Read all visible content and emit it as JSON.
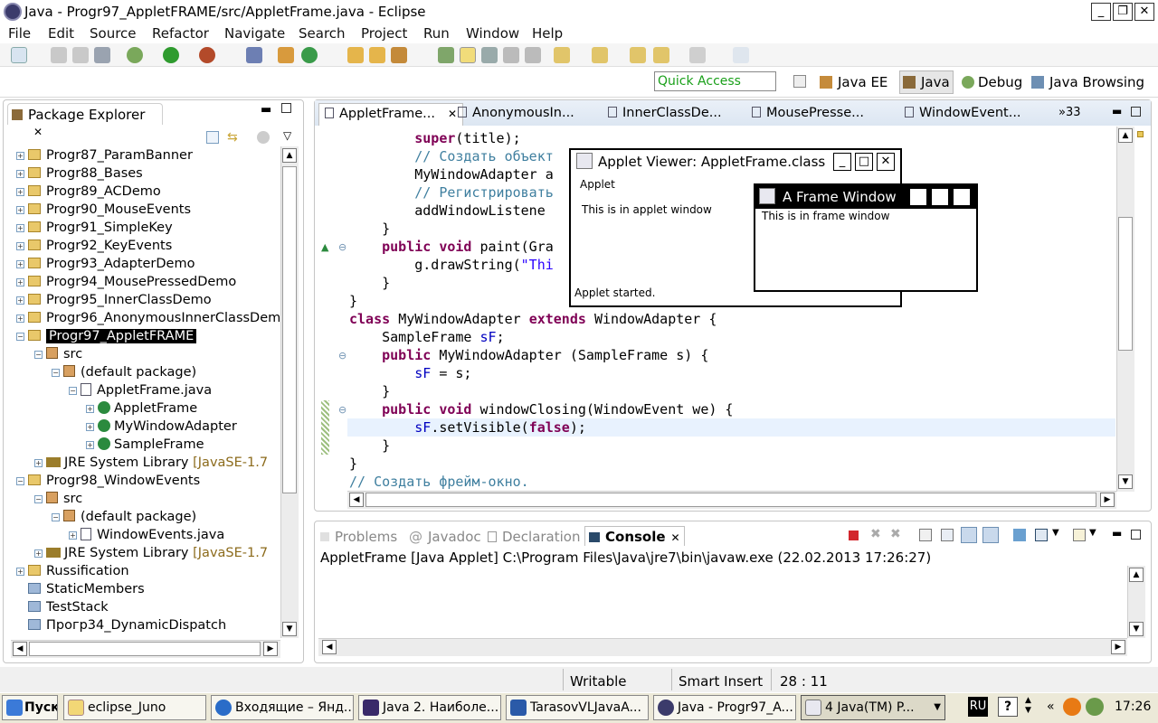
{
  "window": {
    "title": "Java - Progr97_AppletFRAME/src/AppletFrame.java - Eclipse"
  },
  "menu": [
    "File",
    "Edit",
    "Source",
    "Refactor",
    "Navigate",
    "Search",
    "Project",
    "Run",
    "Window",
    "Help"
  ],
  "quick_access": "Quick Access",
  "perspectives": [
    "Java EE",
    "Java",
    "Debug",
    "Java Browsing"
  ],
  "package_explorer": {
    "title": "Package Explorer",
    "rows": [
      "Progr87_ParamBanner",
      "Progr88_Bases",
      "Progr89_ACDemo",
      "Progr90_MouseEvents",
      "Progr91_SimpleKey",
      "Progr92_KeyEvents",
      "Progr93_AdapterDemo",
      "Progr94_MousePressedDemo",
      "Progr95_InnerClassDemo",
      "Progr96_AnonymousInnerClassDem",
      "Progr97_AppletFRAME",
      "src",
      "(default package)",
      "AppletFrame.java",
      "AppletFrame",
      "MyWindowAdapter",
      "SampleFrame",
      "JRE System Library",
      "Progr98_WindowEvents",
      "src",
      "(default package)",
      "WindowEvents.java",
      "JRE System Library",
      "Russification",
      "StaticMembers",
      "TestStack",
      "Прогр34_DynamicDispatch"
    ],
    "jre_suffix": "[JavaSE-1.7"
  },
  "editor": {
    "tabs": [
      "AppletFrame...",
      "AnonymousIn...",
      "InnerClassDe...",
      "MousePresse...",
      "WindowEvent..."
    ],
    "more_tabs": "»33",
    "code": {
      "l1a": "super",
      "l1b": "(title);",
      "l2": "// Создать объект",
      "l3": "MyWindowAdapter a",
      "l4": "// Регистрировать",
      "l5": "addWindowListene",
      "l6": "}",
      "l7a": "public",
      "l7b": "void",
      "l7c": "paint(Gra",
      "l8a": "g.drawString(",
      "l8b": "\"Thi",
      "l9": "}",
      "l10": "}",
      "l11a": "class",
      "l11b": "MyWindowAdapter",
      "l11c": "extends",
      "l11d": "WindowAdapter {",
      "l12a": "SampleFrame",
      "l12b": "sF",
      "l12c": ";",
      "l13a": "public",
      "l13b": "MyWindowAdapter (SampleFrame s) {",
      "l14a": "sF",
      "l14b": "= s;",
      "l15": "}",
      "l16a": "public",
      "l16b": "void",
      "l16c": "windowClosing(WindowEvent we) {",
      "l17a": "sF",
      "l17b": ".setVisible(",
      "l17c": "false",
      "l17d": ");",
      "l18": "}",
      "l19": "}",
      "l20": "// Создать фрейм-окно."
    }
  },
  "applet_viewer": {
    "title": "Applet Viewer: AppletFrame.class",
    "menu": "Applet",
    "text": "This is in applet window",
    "status": "Applet started."
  },
  "frame_window": {
    "title": "A Frame Window",
    "text": "This is in frame window"
  },
  "bottom_tabs": [
    "Problems",
    "Javadoc",
    "Declaration",
    "Console"
  ],
  "console": {
    "line": "AppletFrame [Java Applet] C:\\Program Files\\Java\\jre7\\bin\\javaw.exe (22.02.2013 17:26:27)"
  },
  "status": {
    "writable": "Writable",
    "insert": "Smart Insert",
    "position": "28 : 11"
  },
  "taskbar": {
    "start": "Пуск",
    "tasks": [
      "eclipse_Juno",
      "Входящие – Янд...",
      "Java 2. Наиболе...",
      "TarasovVLJavaA...",
      "Java - Progr97_A...",
      "4 Java(TM) P..."
    ],
    "lang": "RU",
    "clock": "17:26"
  },
  "colors": {
    "keyword": "#7f0055",
    "comment": "#3f7f9f",
    "field": "#0000c0",
    "string": "#2a00ff"
  }
}
